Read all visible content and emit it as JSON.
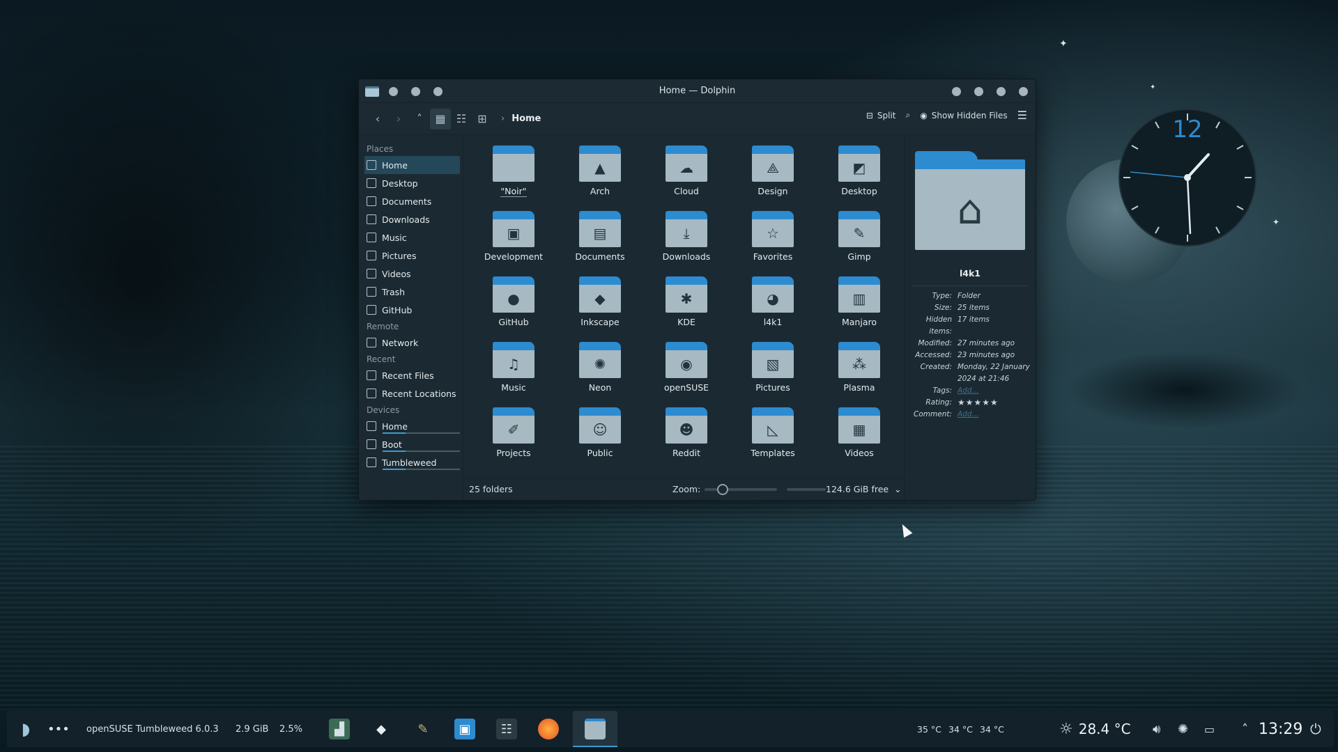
{
  "window": {
    "title": "Home — Dolphin"
  },
  "toolbar": {
    "breadcrumb": "Home",
    "split_label": "Split",
    "hidden_files_label": "Show Hidden Files"
  },
  "sidebar": {
    "places_title": "Places",
    "places": [
      {
        "label": "Home",
        "icon": "home-icon"
      },
      {
        "label": "Desktop",
        "icon": "desktop-icon"
      },
      {
        "label": "Documents",
        "icon": "documents-icon"
      },
      {
        "label": "Downloads",
        "icon": "downloads-icon"
      },
      {
        "label": "Music",
        "icon": "music-icon"
      },
      {
        "label": "Pictures",
        "icon": "pictures-icon"
      },
      {
        "label": "Videos",
        "icon": "videos-icon"
      },
      {
        "label": "Trash",
        "icon": "trash-icon"
      },
      {
        "label": "GitHub",
        "icon": "github-icon"
      }
    ],
    "remote_title": "Remote",
    "remote": [
      {
        "label": "Network",
        "icon": "network-icon"
      }
    ],
    "recent_title": "Recent",
    "recent": [
      {
        "label": "Recent Files",
        "icon": "recent-files-icon"
      },
      {
        "label": "Recent Locations",
        "icon": "recent-locations-icon"
      }
    ],
    "devices_title": "Devices",
    "devices": [
      {
        "label": "Home",
        "icon": "drive-icon"
      },
      {
        "label": "Boot",
        "icon": "drive-icon"
      },
      {
        "label": "Tumbleweed",
        "icon": "drive-icon"
      }
    ]
  },
  "folders": [
    {
      "label": "\"Noir\"",
      "glyph": ""
    },
    {
      "label": "Arch",
      "glyph": "▲"
    },
    {
      "label": "Cloud",
      "glyph": "☁"
    },
    {
      "label": "Design",
      "glyph": "⟁"
    },
    {
      "label": "Desktop",
      "glyph": "◩"
    },
    {
      "label": "Development",
      "glyph": "▣"
    },
    {
      "label": "Documents",
      "glyph": "▤"
    },
    {
      "label": "Downloads",
      "glyph": "⤓"
    },
    {
      "label": "Favorites",
      "glyph": "☆"
    },
    {
      "label": "Gimp",
      "glyph": "✎"
    },
    {
      "label": "GitHub",
      "glyph": "●"
    },
    {
      "label": "Inkscape",
      "glyph": "◆"
    },
    {
      "label": "KDE",
      "glyph": "✱"
    },
    {
      "label": "l4k1",
      "glyph": "◕"
    },
    {
      "label": "Manjaro",
      "glyph": "▥"
    },
    {
      "label": "Music",
      "glyph": "♫"
    },
    {
      "label": "Neon",
      "glyph": "✺"
    },
    {
      "label": "openSUSE",
      "glyph": "◉"
    },
    {
      "label": "Pictures",
      "glyph": "▧"
    },
    {
      "label": "Plasma",
      "glyph": "⁂"
    },
    {
      "label": "Projects",
      "glyph": "✐"
    },
    {
      "label": "Public",
      "glyph": "☺"
    },
    {
      "label": "Reddit",
      "glyph": "☻"
    },
    {
      "label": "Templates",
      "glyph": "◺"
    },
    {
      "label": "Videos",
      "glyph": "▦"
    }
  ],
  "statusbar": {
    "count": "25 folders",
    "zoom_label": "Zoom:",
    "free_space": "124.6 GiB free"
  },
  "info_panel": {
    "name": "l4k1",
    "rows": [
      {
        "k": "Type:",
        "v": "Folder"
      },
      {
        "k": "Size:",
        "v": "25 items"
      },
      {
        "k": "Hidden items:",
        "v": "17 items"
      },
      {
        "k": "Modified:",
        "v": "27 minutes ago"
      },
      {
        "k": "Accessed:",
        "v": "23 minutes ago"
      },
      {
        "k": "Created:",
        "v": "Monday, 22 January 2024 at 21:46"
      }
    ],
    "tags_label": "Tags:",
    "tags_value": "Add...",
    "rating_label": "Rating:",
    "rating_stars": "★★★★★",
    "comment_label": "Comment:",
    "comment_value": "Add..."
  },
  "clock_widget": {
    "numeral": "12"
  },
  "panel": {
    "distro_label": "openSUSE Tumbleweed 6.0.3",
    "memory": "2.9 GiB",
    "cpu": "2.5%",
    "temps": [
      "35 °C",
      "34 °C",
      "34 °C"
    ],
    "weather_temp": "28.4 °C",
    "time": "13:29"
  },
  "colors": {
    "accent": "#2d8bd0",
    "folder_body": "#a7b9c2",
    "window_bg": "#1b2a32"
  }
}
